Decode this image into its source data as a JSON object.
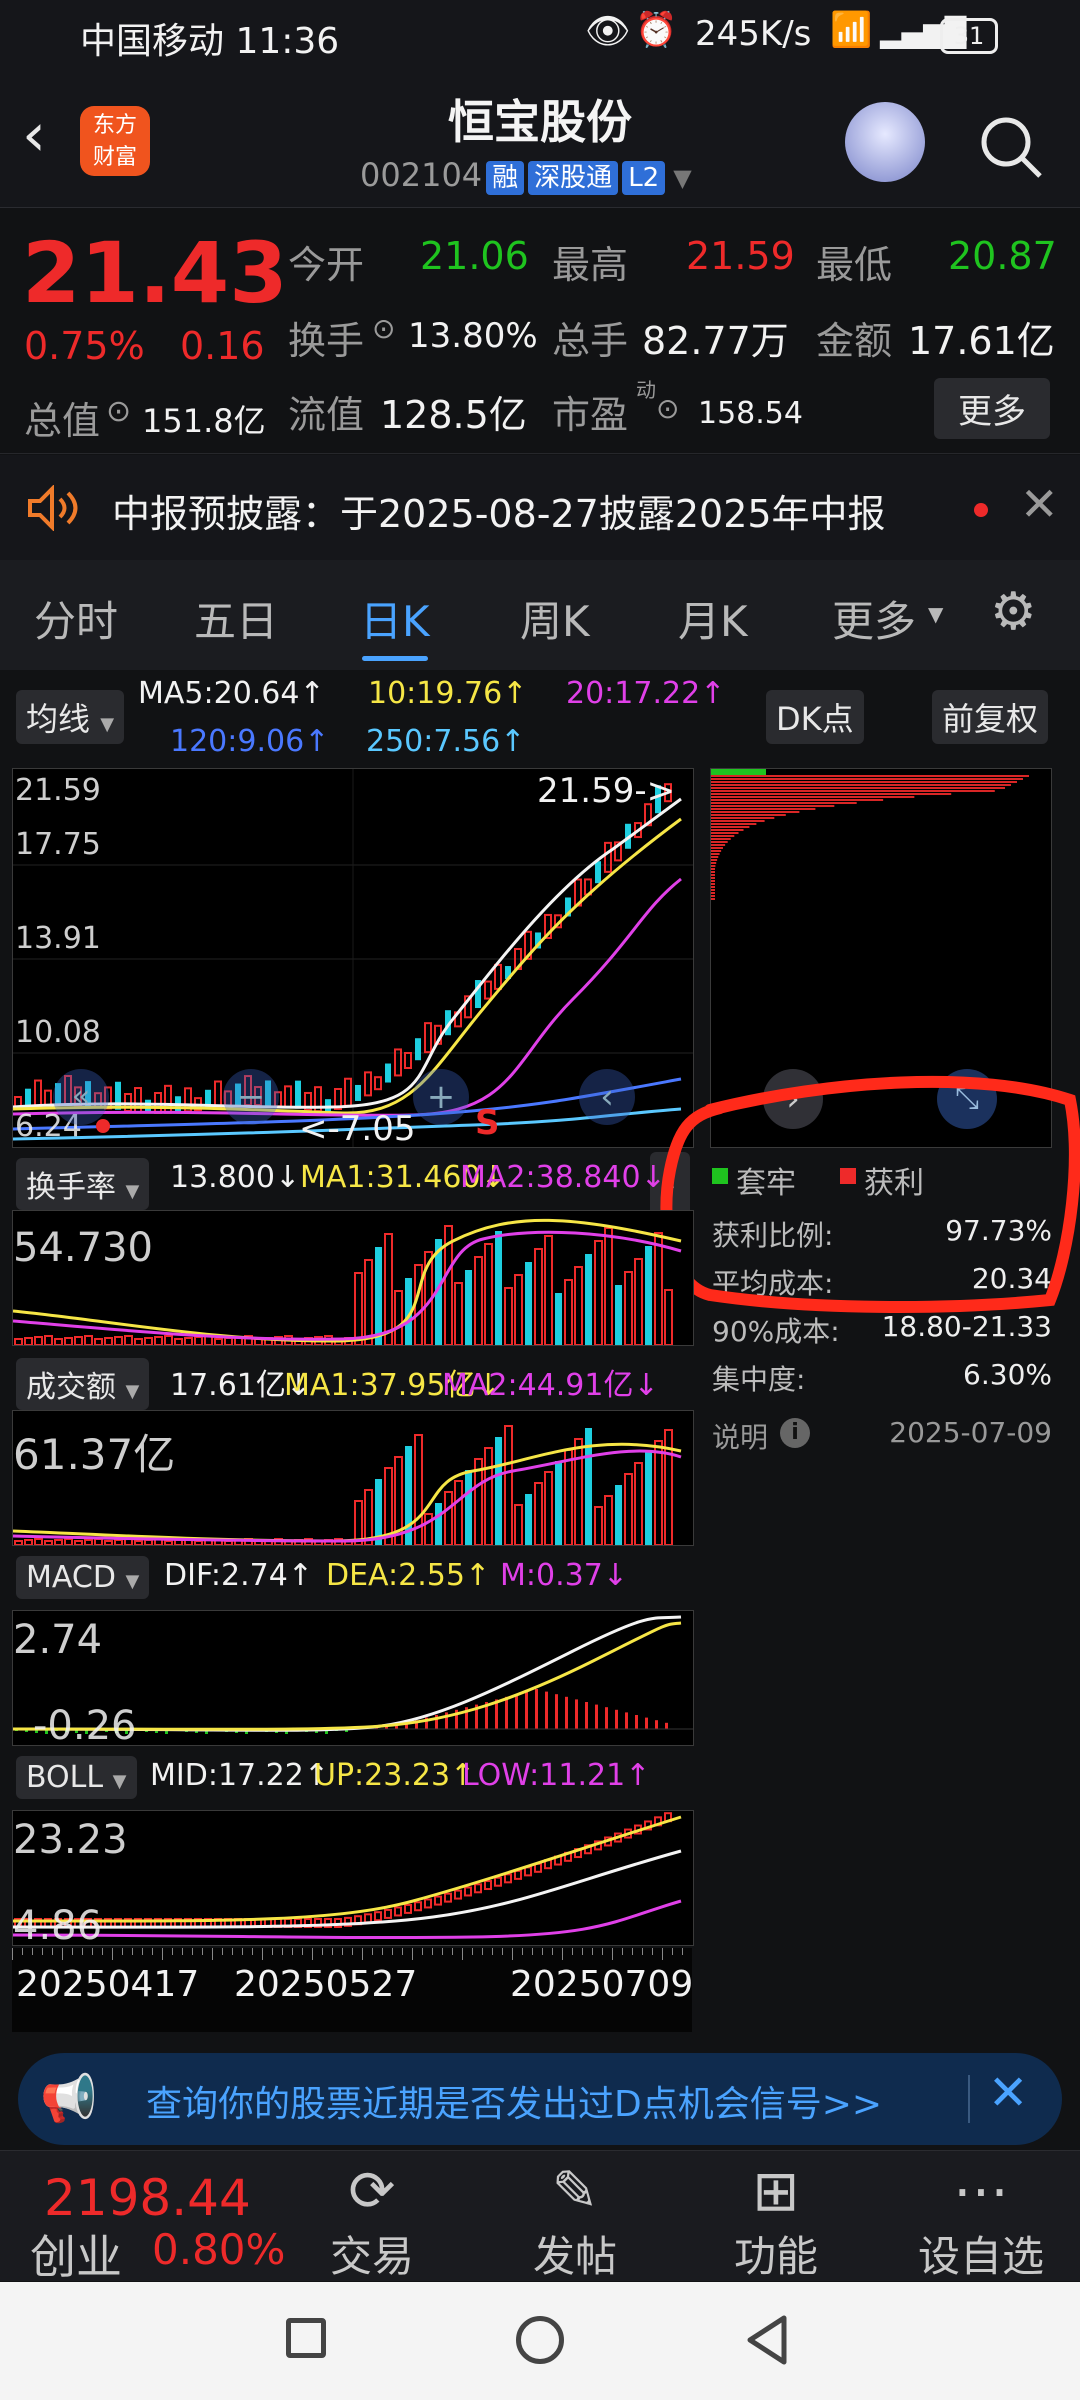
{
  "status_bar": {
    "carrier_time": "中国移动 11:36",
    "speed": "245K/s",
    "battery": "31"
  },
  "header": {
    "title": "恒宝股份",
    "code": "002104",
    "tags": [
      "融",
      "深股通",
      "L2"
    ],
    "logo_text": "东方\n财富"
  },
  "quote": {
    "price": "21.43",
    "change_pct": "0.75%",
    "change": "0.16",
    "open_label": "今开",
    "open": "21.06",
    "high_label": "最高",
    "high": "21.59",
    "low_label": "最低",
    "low": "20.87",
    "turnover_label": "换手",
    "turnover": "13.80%",
    "volume_label": "总手",
    "volume": "82.77万",
    "amount_label": "金额",
    "amount": "17.61亿",
    "mktcap_label": "总值",
    "mktcap": "151.8亿",
    "float_label": "流值",
    "float": "128.5亿",
    "pe_label": "市盈",
    "pe_sup": "动",
    "pe": "158.54",
    "more": "更多"
  },
  "notice": {
    "text": "中报预披露：于2025-08-27披露2025年中报"
  },
  "tabs": [
    "分时",
    "五日",
    "日K",
    "周K",
    "月K",
    "更多"
  ],
  "kline": {
    "ma_button": "均线",
    "dk_button": "DK点",
    "adjust_button": "前复权",
    "ma5": "MA5:20.64↑",
    "ma10": "10:19.76↑",
    "ma20": "20:17.22↑",
    "ma120": "120:9.06↑",
    "ma250": "250:7.56↑",
    "y_labels": [
      "21.59",
      "17.75",
      "13.91",
      "10.08",
      "6.24"
    ],
    "max_mark": "21.59",
    "min_mark": "7.05",
    "s_mark": "S"
  },
  "chip": {
    "legend_trapped": "套牢",
    "legend_profit": "获利",
    "profit_ratio_label": "获利比例:",
    "profit_ratio": "97.73%",
    "avg_cost_label": "平均成本:",
    "avg_cost": "20.34",
    "cost90_label": "90%成本:",
    "cost90": "18.80-21.33",
    "concentration_label": "集中度:",
    "concentration": "6.30%",
    "explain": "说明",
    "date": "2025-07-09"
  },
  "turnover_ind": {
    "name": "换手率",
    "v": "13.800↓",
    "ma1": "MA1:31.460↓",
    "ma2": "MA2:38.840↓",
    "y": "54.730"
  },
  "amount_ind": {
    "name": "成交额",
    "v": "17.61亿↓",
    "ma1": "MA1:37.95亿↓",
    "ma2": "MA2:44.91亿↓",
    "y": "61.37亿"
  },
  "macd_ind": {
    "name": "MACD",
    "dif": "DIF:2.74↑",
    "dea": "DEA:2.55↑",
    "m": "M:0.37↓",
    "y_top": "2.74",
    "y_bot": "-0.26"
  },
  "boll_ind": {
    "name": "BOLL",
    "mid": "MID:17.22↑",
    "up": "UP:23.23↑",
    "low": "LOW:11.21↑",
    "y_top": "23.23",
    "y_bot": "4.86"
  },
  "dates": [
    "20250417",
    "20250527",
    "20250709"
  ],
  "banner": {
    "text": "查询你的股票近期是否发出过D点机会信号>>"
  },
  "bottom": {
    "index_value": "2198.44",
    "index_name": "创业",
    "index_pct": "0.80%",
    "items": [
      "交易",
      "发帖",
      "功能",
      "设自选"
    ]
  },
  "colors": {
    "up": "#ee2a2a",
    "down": "#1fc41f",
    "accent": "#4aa3ff",
    "annotation": "#ff2a1a"
  }
}
